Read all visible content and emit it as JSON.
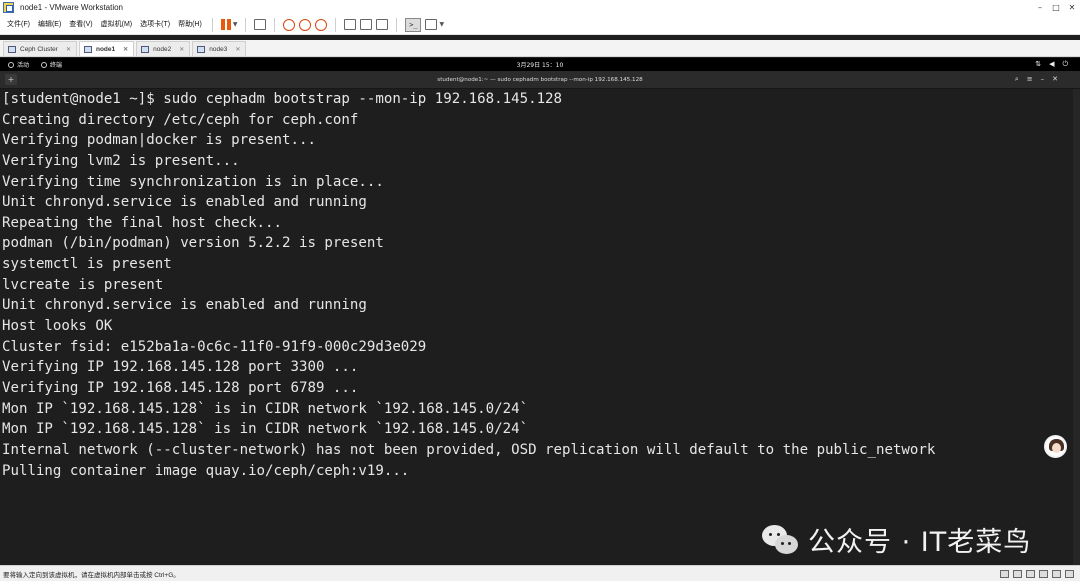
{
  "window": {
    "title": "node1 - VMware Workstation",
    "controls": [
      "–",
      "□",
      "✕"
    ]
  },
  "menu": [
    "文件(F)",
    "编辑(E)",
    "查看(V)",
    "虚拟机(M)",
    "选项卡(T)",
    "帮助(H)"
  ],
  "tabs": [
    {
      "label": "Ceph Cluster",
      "close": "✕"
    },
    {
      "label": "node1",
      "close": "✕"
    },
    {
      "label": "node2",
      "close": "✕"
    },
    {
      "label": "node3",
      "close": "✕"
    }
  ],
  "gnome": {
    "activities": "活动",
    "app": "终端",
    "clock": "3月29日 15：10"
  },
  "terminal": {
    "title": "student@node1:~ — sudo cephadm bootstrap --mon-ip 192.168.145.128",
    "new_tab": "+",
    "controls": [
      "⌕",
      "≡",
      "–",
      "✕"
    ],
    "lines": [
      "[student@node1 ~]$ sudo cephadm bootstrap --mon-ip 192.168.145.128",
      "Creating directory /etc/ceph for ceph.conf",
      "Verifying podman|docker is present...",
      "Verifying lvm2 is present...",
      "Verifying time synchronization is in place...",
      "Unit chronyd.service is enabled and running",
      "Repeating the final host check...",
      "podman (/bin/podman) version 5.2.2 is present",
      "systemctl is present",
      "lvcreate is present",
      "Unit chronyd.service is enabled and running",
      "Host looks OK",
      "Cluster fsid: e152ba1a-0c6c-11f0-91f9-000c29d3e029",
      "Verifying IP 192.168.145.128 port 3300 ...",
      "Verifying IP 192.168.145.128 port 6789 ...",
      "Mon IP `192.168.145.128` is in CIDR network `192.168.145.0/24`",
      "Mon IP `192.168.145.128` is in CIDR network `192.168.145.0/24`",
      "Internal network (--cluster-network) has not been provided, OSD replication will default to the public_network",
      "Pulling container image quay.io/ceph/ceph:v19..."
    ]
  },
  "watermark": "公众号 · IT老菜鸟",
  "status": "要将输入定向到该虚拟机，请在虚拟机内部单击或按 Ctrl+G。"
}
